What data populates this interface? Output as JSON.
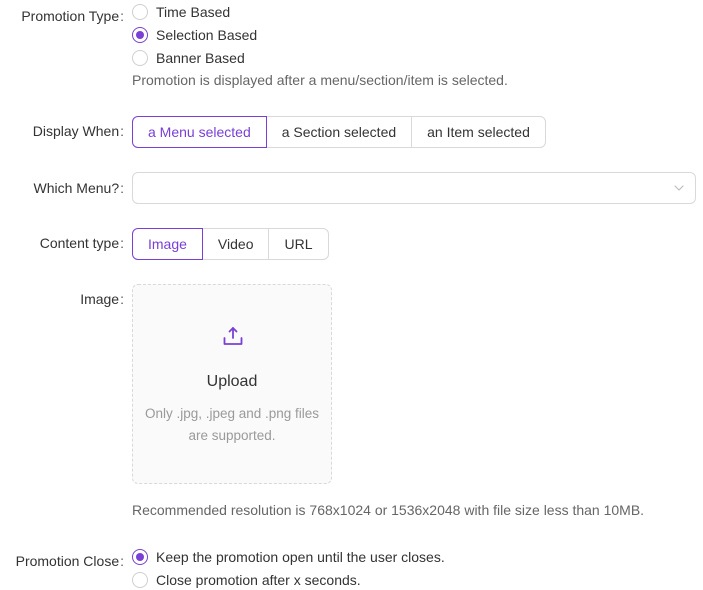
{
  "promotion_type": {
    "label": "Promotion Type",
    "options": [
      {
        "label": "Time Based",
        "checked": false
      },
      {
        "label": "Selection Based",
        "checked": true
      },
      {
        "label": "Banner Based",
        "checked": false
      }
    ],
    "helper": "Promotion is displayed after a menu/section/item is selected."
  },
  "display_when": {
    "label": "Display When",
    "options": [
      "a Menu selected",
      "a Section selected",
      "an Item selected"
    ],
    "selected": "a Menu selected"
  },
  "which_menu": {
    "label": "Which Menu?",
    "value": "",
    "icon": "chevron-down-icon"
  },
  "content_type": {
    "label": "Content type",
    "options": [
      "Image",
      "Video",
      "URL"
    ],
    "selected": "Image"
  },
  "image": {
    "label": "Image",
    "upload_title": "Upload",
    "upload_hint_line1": "Only .jpg, .jpeg and .png files",
    "upload_hint_line2": "are supported.",
    "upload_icon": "upload-icon",
    "resolution_note": "Recommended resolution is 768x1024 or 1536x2048 with file size less than 10MB."
  },
  "promotion_close": {
    "label": "Promotion Close",
    "options": [
      {
        "label": "Keep the promotion open until the user closes.",
        "checked": true
      },
      {
        "label": "Close promotion after x seconds.",
        "checked": false
      }
    ]
  },
  "colors": {
    "accent": "#7a3fd6",
    "border": "#d9d9d9",
    "text": "#333333",
    "muted": "#666666"
  }
}
